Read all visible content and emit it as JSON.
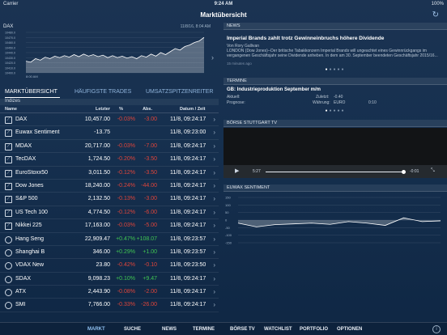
{
  "status": {
    "carrier": "Carrier",
    "time": "9:24 AM",
    "battery": "100%"
  },
  "header": {
    "title": "Marktübersicht"
  },
  "mini_chart": {
    "symbol": "DAX",
    "date": "11/8/16, 8:04 AM",
    "time_label": "8:00 AM",
    "y_ticks": [
      "10480.0",
      "10470.0",
      "10460.0",
      "10450.0",
      "10440.0",
      "10430.0",
      "10420.0",
      "10410.0",
      "10400.0"
    ],
    "values": [
      10423,
      10421,
      10428,
      10425,
      10431,
      10428,
      10433,
      10430,
      10434,
      10431,
      10436,
      10432,
      10437,
      10433,
      10436,
      10432,
      10435,
      10430,
      10434,
      10430,
      10433,
      10429,
      10432,
      10428,
      10434,
      10431,
      10437,
      10433,
      10440,
      10436,
      10442,
      10448,
      10445,
      10452,
      10455,
      10460,
      10463,
      10470
    ]
  },
  "tabs": {
    "marktuebersicht": "MARKTÜBERSICHT",
    "haeufigste": "HÄUFIGSTE TRADES",
    "umsatz": "UMSATZSPITZENREITER"
  },
  "table": {
    "section": "Indizes",
    "headers": {
      "name": "Name",
      "last": "Letzter",
      "pct": "%",
      "abs": "Abs.",
      "datetime": "Datum / Zeit"
    },
    "rows": [
      {
        "name": "DAX",
        "last": "10,457.00",
        "pct": "-0.03%",
        "abs": "-3.00",
        "dt": "11/8, 09:24:17",
        "dir": "neg"
      },
      {
        "name": "Euwax Sentiment",
        "last": "-13.75",
        "pct": "",
        "abs": "",
        "dt": "11/8, 09:23:00",
        "dir": "none"
      },
      {
        "name": "MDAX",
        "last": "20,717.00",
        "pct": "-0.03%",
        "abs": "-7.00",
        "dt": "11/8, 09:24:17",
        "dir": "neg"
      },
      {
        "name": "TecDAX",
        "last": "1,724.50",
        "pct": "-0.20%",
        "abs": "-3.50",
        "dt": "11/8, 09:24:17",
        "dir": "neg"
      },
      {
        "name": "EuroStoxx50",
        "last": "3,011.50",
        "pct": "-0.12%",
        "abs": "-3.50",
        "dt": "11/8, 09:24:17",
        "dir": "neg"
      },
      {
        "name": "Dow Jones",
        "last": "18,240.00",
        "pct": "-0.24%",
        "abs": "-44.00",
        "dt": "11/8, 09:24:17",
        "dir": "neg"
      },
      {
        "name": "S&P 500",
        "last": "2,132.50",
        "pct": "-0.13%",
        "abs": "-3.00",
        "dt": "11/8, 09:24:17",
        "dir": "neg"
      },
      {
        "name": "US Tech 100",
        "last": "4,774.50",
        "pct": "-0.12%",
        "abs": "-6.00",
        "dt": "11/8, 09:24:17",
        "dir": "neg"
      },
      {
        "name": "Nikkei 225",
        "last": "17,163.00",
        "pct": "-0.03%",
        "abs": "-5.00",
        "dt": "11/8, 09:24:17",
        "dir": "neg"
      },
      {
        "name": "Hang Seng",
        "last": "22,909.47",
        "pct": "+0.47%",
        "abs": "+108.07",
        "dt": "11/8, 09:23:57",
        "dir": "pos"
      },
      {
        "name": "Shanghai B",
        "last": "346.00",
        "pct": "+0.29%",
        "abs": "+1.00",
        "dt": "11/8, 09:23:57",
        "dir": "pos"
      },
      {
        "name": "VDAX New",
        "last": "23.80",
        "pct": "-0.42%",
        "abs": "-0.10",
        "dt": "11/8, 09:23:50",
        "dir": "neg"
      },
      {
        "name": "SDAX",
        "last": "9,098.23",
        "pct": "+0.10%",
        "abs": "+9.47",
        "dt": "11/8, 09:24:17",
        "dir": "pos"
      },
      {
        "name": "ATX",
        "last": "2,443.90",
        "pct": "-0.08%",
        "abs": "-2.00",
        "dt": "11/8, 09:24:17",
        "dir": "neg"
      },
      {
        "name": "SMI",
        "last": "7,766.00",
        "pct": "-0.33%",
        "abs": "-26.00",
        "dt": "11/8, 09:24:17",
        "dir": "neg"
      }
    ]
  },
  "news": {
    "header": "NEWS",
    "title": "Imperial Brands zahlt trotz Gewinneinbruchs höhere Dividende",
    "author": "Von Rory Gallivan",
    "body": "LONDON (Dow Jones)--Der britische Tabakkonzern Imperial Brands will ungeachtet eines Gewinnrückgangs im vergangenen Geschäftsjahr seine Dividende anheben. In dem am 30. September beendeten Geschäftsjahr 2015/16...",
    "time": "15 minutes ago"
  },
  "termine": {
    "header": "TERMINE",
    "title": "GB: Industrieproduktion September m/m",
    "aktuell_label": "Aktuell:",
    "zuletzt_label": "Zuletzt:",
    "zuletzt_value": "-0.40",
    "prognose_label": "Prognose:",
    "waehrung_label": "Währung:",
    "waehrung_value": "EURO",
    "time_value": "0:10"
  },
  "tv": {
    "header": "BÖRSE STUTTGART TV",
    "elapsed": "5:27",
    "remaining": "-0:01"
  },
  "sentiment": {
    "header": "EUWAX SENTIMENT",
    "y_ticks": [
      "150",
      "100",
      "50",
      "0",
      "-50",
      "-100",
      "-150"
    ],
    "values": [
      -20,
      -45,
      -30,
      -25,
      -20,
      -28,
      -10,
      -20,
      -35,
      15,
      -10,
      -5
    ]
  },
  "tabbar": {
    "markt": "MARKT",
    "suche": "SUCHE",
    "news": "NEWS",
    "termine": "TERMINE",
    "tv": "BÖRSE TV",
    "watchlist": "WATCHLIST",
    "portfolio": "PORTFOLIO",
    "optionen": "OPTIONEN",
    "info": "i"
  },
  "colors": {
    "negative": "#e0453a",
    "positive": "#40c552",
    "accent": "#8fc0f0"
  }
}
